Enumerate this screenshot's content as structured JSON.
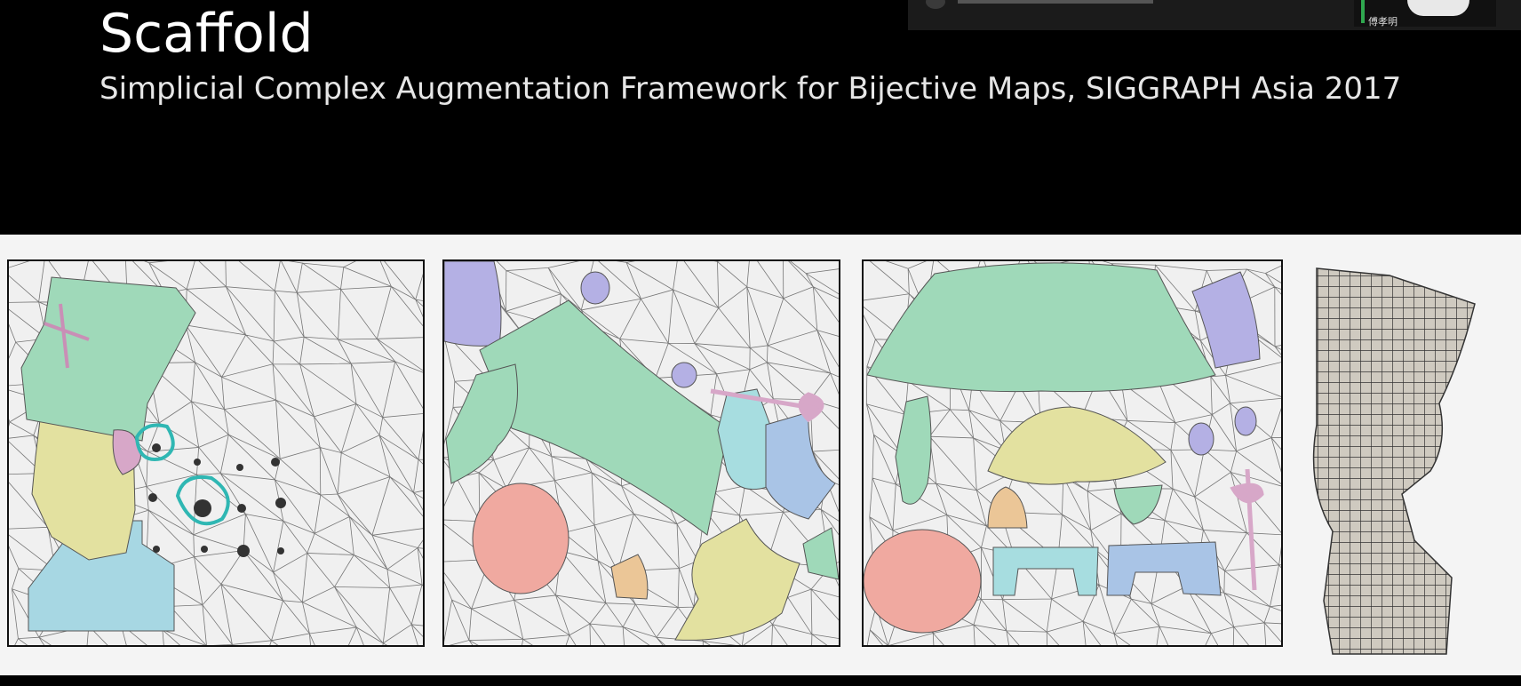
{
  "slide": {
    "title": "Scaffold",
    "subtitle": "Simplicial Complex Augmentation Framework for Bijective Maps, SIGGRAPH Asia 2017"
  },
  "presenter": {
    "name": "傅孝明"
  },
  "figure": {
    "panels": [
      {
        "id": "input-mesh"
      },
      {
        "id": "intermediate-uv"
      },
      {
        "id": "final-uv"
      },
      {
        "id": "textured-result"
      }
    ]
  },
  "colors": {
    "background": "#000000",
    "figure_bg": "#f4f4f4",
    "green_chart": "#9fd9b9",
    "yellow_chart": "#e3e1a0",
    "blue_chart": "#a9c4e6",
    "cyan_chart": "#a7dde0",
    "purple_chart": "#b4b0e4",
    "red_chart": "#f0a9a0",
    "orange_chart": "#ebc697",
    "pink_chart": "#d7a7c8",
    "highlight": "#2fb7b3",
    "wire": "#777777"
  }
}
